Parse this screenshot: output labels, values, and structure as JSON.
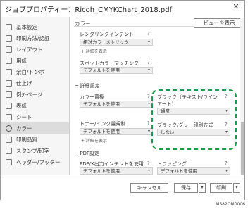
{
  "window": {
    "title": "ジョブプロパティー：Ricoh_CMYKChart_2018.pdf",
    "close_glyph": "✕"
  },
  "sidebar": {
    "items": [
      {
        "label": "基本設定",
        "icon": "basic-settings-icon"
      },
      {
        "label": "印刷方法/認証",
        "icon": "print-method-icon"
      },
      {
        "label": "レイアウト",
        "icon": "layout-icon"
      },
      {
        "label": "用紙",
        "icon": "paper-icon"
      },
      {
        "label": "余白/トンボ",
        "icon": "margin-icon"
      },
      {
        "label": "仕上げ",
        "icon": "finishing-icon"
      },
      {
        "label": "例外ページ",
        "icon": "exception-page-icon"
      },
      {
        "label": "表紙",
        "icon": "cover-icon"
      },
      {
        "label": "シート",
        "icon": "sheet-icon"
      },
      {
        "label": "カラー",
        "icon": "color-icon",
        "active": true
      },
      {
        "label": "印刷品質",
        "icon": "print-quality-icon"
      },
      {
        "label": "スタンプ/印字",
        "icon": "stamp-icon"
      },
      {
        "label": "ヘッダー/フッター",
        "icon": "header-footer-icon"
      }
    ]
  },
  "content": {
    "section_title": "カラー",
    "preview_button": "ビューを表示",
    "rendering_intent": {
      "label": "レンダリングインテント",
      "help": "?",
      "value": "相対カラーメトリック",
      "details": "+ 詳細を表示"
    },
    "spot_color": {
      "label": "スポットカラーマッチング",
      "help": "?",
      "value": "デフォルトを使用"
    },
    "advanced": {
      "label": "─ 詳細設定"
    },
    "color_replace": {
      "label": "カラー置換",
      "help": "?",
      "value": "デフォルトを使用"
    },
    "black_text": {
      "label": "ブラック（テキスト/ライン\nアート）",
      "help": "?",
      "value": "通常"
    },
    "toner_limit": {
      "label": "トナー/インク量規制",
      "help": "?",
      "value": "デフォルトを使用",
      "details": "+ 詳細を表示"
    },
    "black_gray": {
      "label": "ブラック/グレー印刷方式",
      "help": "?",
      "value": "しない"
    },
    "pdf": {
      "label": "─ PDF設定"
    },
    "pdfx": {
      "label": "PDF/X出力インテントを使用",
      "help": "?",
      "value": "デフォルトを使用"
    },
    "trapping": {
      "label": "トラッピング",
      "help": "?",
      "value": "デフォルトを使用"
    }
  },
  "footer": {
    "cancel": "キャンセル",
    "save": "保存",
    "print": "印刷"
  },
  "figure_code": "M582OM0006"
}
